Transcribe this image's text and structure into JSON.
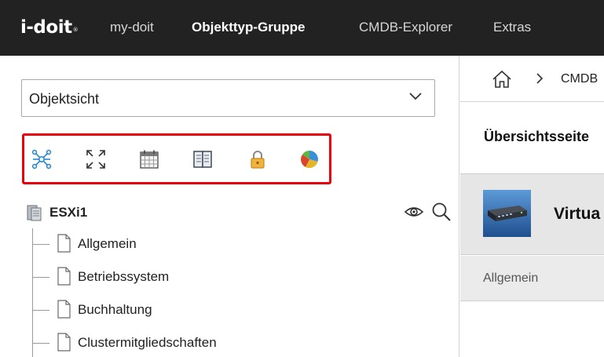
{
  "topbar": {
    "logo": "i-doit",
    "logo_mark": "®",
    "nav": [
      {
        "label": "my-doit"
      },
      {
        "label": "Objekttyp-Gruppe"
      },
      {
        "label": "CMDB-Explorer"
      },
      {
        "label": "Extras"
      }
    ],
    "active": "Objekttyp-Gruppe"
  },
  "left_panel": {
    "view_select": {
      "value": "Objektsicht"
    },
    "toolbar_icons": [
      "network-graph-icon",
      "expand-icon",
      "calendar-icon",
      "book-icon",
      "lock-icon",
      "pie-chart-icon"
    ],
    "highlight_color": "#e8000b",
    "tree": {
      "root": {
        "label": "ESXi1",
        "icon": "server-icon"
      },
      "actions": [
        "eye-icon",
        "search-icon"
      ],
      "items": [
        {
          "label": "Allgemein"
        },
        {
          "label": "Betriebssystem"
        },
        {
          "label": "Buchhaltung"
        },
        {
          "label": "Clustermitgliedschaften"
        }
      ]
    }
  },
  "right_panel": {
    "breadcrumb": {
      "home_icon": "home-icon",
      "items": [
        {
          "label": "CMDB"
        }
      ]
    },
    "page_title": "Übersichtsseite",
    "object": {
      "name": "Virtua",
      "thumbnail_icon": "server-rack-icon"
    },
    "category": "Allgemein"
  },
  "colors": {
    "topbar_bg": "#222222",
    "accent_blue": "#2a8bd0",
    "panel_gray": "#e6e6e6"
  }
}
